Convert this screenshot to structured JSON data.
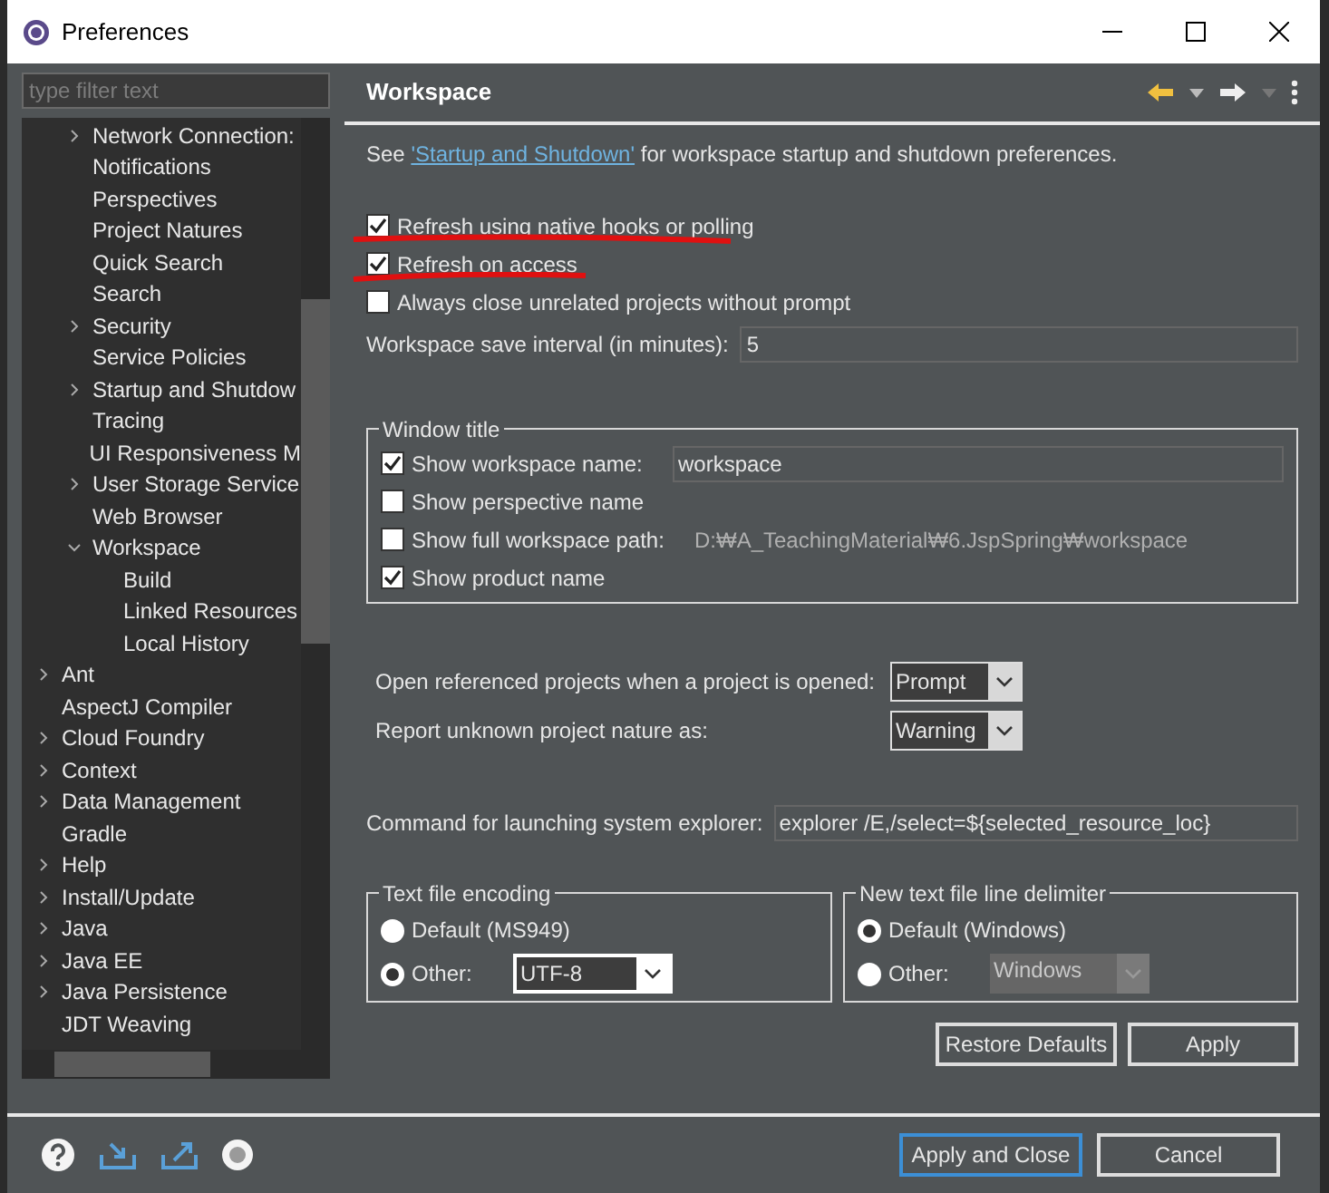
{
  "window": {
    "title": "Preferences"
  },
  "filter": {
    "placeholder": "type filter text"
  },
  "tree": [
    {
      "children": [
        {
          "label": "Network Connection:",
          "expanded": false
        },
        {
          "label": "Notifications"
        },
        {
          "label": "Perspectives"
        },
        {
          "label": "Project Natures"
        },
        {
          "label": "Quick Search"
        },
        {
          "label": "Search"
        },
        {
          "label": "Security",
          "expanded": false
        },
        {
          "label": "Service Policies"
        },
        {
          "label": "Startup and Shutdow",
          "expanded": false
        },
        {
          "label": "Tracing"
        },
        {
          "label": "UI Responsiveness M"
        },
        {
          "label": "User Storage Service",
          "expanded": false
        },
        {
          "label": "Web Browser"
        },
        {
          "label": "Workspace",
          "expanded": true,
          "children": [
            {
              "label": "Build"
            },
            {
              "label": "Linked Resources"
            },
            {
              "label": "Local History"
            }
          ]
        }
      ]
    },
    {
      "label": "Ant",
      "expanded": false
    },
    {
      "label": "AspectJ Compiler"
    },
    {
      "label": "Cloud Foundry",
      "expanded": false
    },
    {
      "label": "Context",
      "expanded": false
    },
    {
      "label": "Data Management",
      "expanded": false
    },
    {
      "label": "Gradle"
    },
    {
      "label": "Help",
      "expanded": false
    },
    {
      "label": "Install/Update",
      "expanded": false
    },
    {
      "label": "Java",
      "expanded": false
    },
    {
      "label": "Java EE",
      "expanded": false
    },
    {
      "label": "Java Persistence",
      "expanded": false
    },
    {
      "label": "JDT Weaving"
    }
  ],
  "page": {
    "title": "Workspace",
    "intro": {
      "before": "See ",
      "link": "'Startup and Shutdown'",
      "after": " for workspace startup and shutdown preferences."
    },
    "options": [
      {
        "label": "Refresh using native hooks or polling",
        "checked": true,
        "underlined": true
      },
      {
        "label": "Refresh on access",
        "checked": true,
        "underlined": true
      },
      {
        "label": "Always close unrelated projects without prompt",
        "checked": false,
        "underlined": false
      }
    ],
    "save_interval": {
      "label": "Workspace save interval (in minutes):",
      "value": "5"
    },
    "window_title": {
      "title": "Window title",
      "rows": [
        {
          "label": "Show workspace name:",
          "checked": true,
          "kind": "field",
          "value": "workspace"
        },
        {
          "label": "Show perspective name",
          "checked": false,
          "kind": "plain"
        },
        {
          "label": "Show full workspace path:",
          "checked": false,
          "kind": "path",
          "value": "D:₩A_TeachingMaterial₩6.JspSpring₩workspace"
        },
        {
          "label": "Show product name",
          "checked": true,
          "kind": "plain"
        }
      ]
    },
    "selects": [
      {
        "label": "Open referenced projects when a project is opened:",
        "value": "Prompt"
      },
      {
        "label": "Report unknown project nature as:",
        "value": "Warning"
      }
    ],
    "command": {
      "label": "Command for launching system explorer:",
      "value": "explorer /E,/select=${selected_resource_loc}"
    },
    "encoding": {
      "title": "Text file encoding",
      "options": [
        {
          "label": "Default (MS949)",
          "selected": false
        },
        {
          "label": "Other:",
          "selected": true,
          "value": "UTF-8",
          "disabled": false
        }
      ]
    },
    "delimiter": {
      "title": "New text file line delimiter",
      "options": [
        {
          "label": "Default (Windows)",
          "selected": true
        },
        {
          "label": "Other:",
          "selected": false,
          "value": "Windows",
          "disabled": true
        }
      ]
    },
    "buttons": [
      "Restore Defaults",
      "Apply"
    ]
  },
  "footer": {
    "buttons": [
      {
        "label": "Apply and Close",
        "default": true
      },
      {
        "label": "Cancel",
        "default": false
      }
    ]
  }
}
